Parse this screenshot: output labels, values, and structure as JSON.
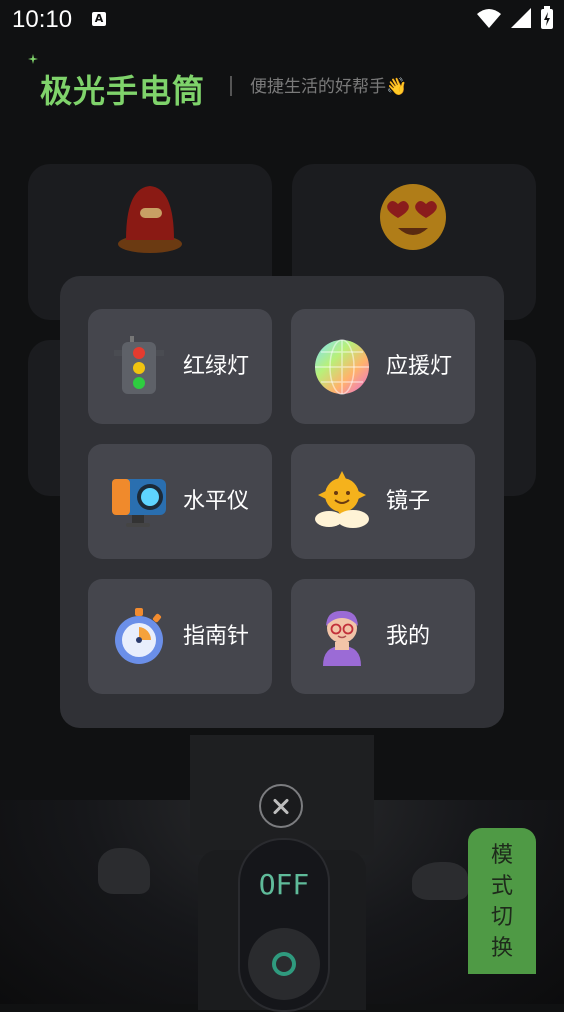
{
  "status_bar": {
    "time": "10:10",
    "notification_letter": "A"
  },
  "header": {
    "title": "极光手电筒",
    "tagline": "便捷生活的好帮手👋"
  },
  "torch": {
    "state_label": "OFF"
  },
  "mode_switch": {
    "label_chars": [
      "模",
      "式",
      "切",
      "换"
    ]
  },
  "menu": {
    "items": [
      {
        "label": "红绿灯",
        "icon": "traffic-light-icon"
      },
      {
        "label": "应援灯",
        "icon": "disco-ball-icon"
      },
      {
        "label": "水平仪",
        "icon": "camera-icon"
      },
      {
        "label": "镜子",
        "icon": "sun-cloud-icon"
      },
      {
        "label": "指南针",
        "icon": "stopwatch-icon"
      },
      {
        "label": "我的",
        "icon": "avatar-icon"
      }
    ]
  },
  "colors": {
    "accent": "#7fd36b",
    "switch": "#4f9a45",
    "popup": "#303136",
    "tile": "#45464d"
  }
}
